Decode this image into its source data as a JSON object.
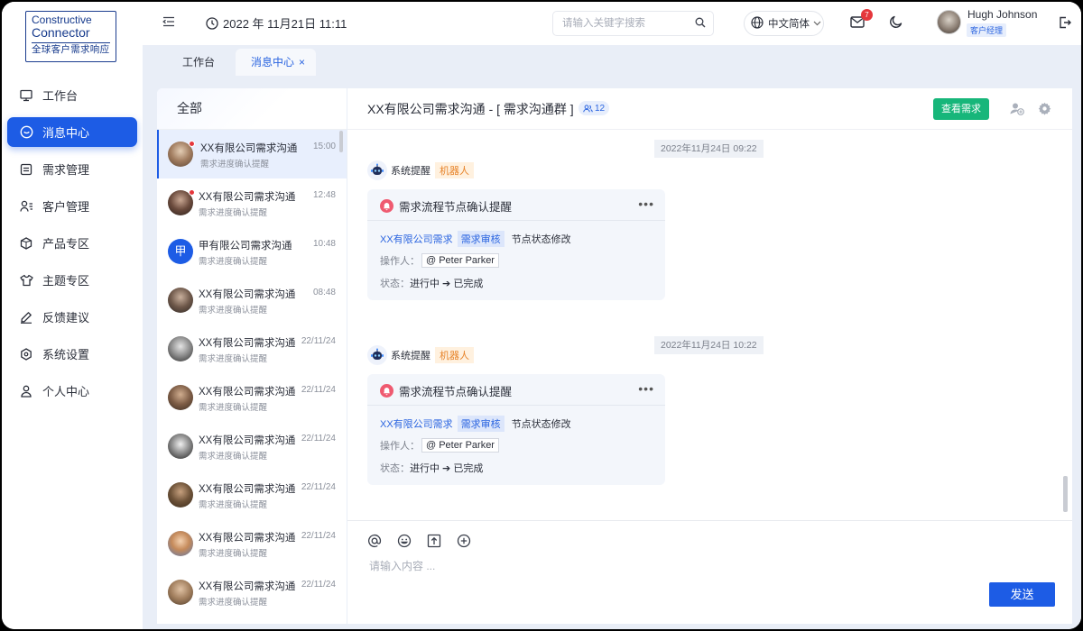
{
  "brand": {
    "line1": "Constructive",
    "line2": "Connector",
    "line3": "全球客户需求响应"
  },
  "sidebar": {
    "items": [
      {
        "label": "工作台",
        "icon": "monitor-icon"
      },
      {
        "label": "消息中心",
        "icon": "message-icon",
        "active": true
      },
      {
        "label": "需求管理",
        "icon": "list-icon"
      },
      {
        "label": "客户管理",
        "icon": "user-list-icon"
      },
      {
        "label": "产品专区",
        "icon": "cube-icon"
      },
      {
        "label": "主题专区",
        "icon": "shirt-icon"
      },
      {
        "label": "反馈建议",
        "icon": "edit-icon"
      },
      {
        "label": "系统设置",
        "icon": "settings-icon"
      },
      {
        "label": "个人中心",
        "icon": "person-icon"
      }
    ]
  },
  "header": {
    "datetime": "2022 年 11月21日 11:11",
    "search_placeholder": "请输入关键字搜索",
    "language": "中文简体",
    "mail_count": "7",
    "user_name": "Hugh  Johnson",
    "user_role": "客户经理"
  },
  "tabs": {
    "tab1": "工作台",
    "tab2": "消息中心",
    "close": "×"
  },
  "conversations": {
    "header": "全部",
    "items": [
      {
        "title": "XX有限公司需求沟通",
        "sub": "需求进度确认提醒",
        "time": "15:00",
        "unread": true
      },
      {
        "title": "XX有限公司需求沟通",
        "sub": "需求进度确认提醒",
        "time": "12:48",
        "unread": true
      },
      {
        "title": "甲有限公司需求沟通",
        "sub": "需求进度确认提醒",
        "time": "10:48",
        "unread": false,
        "letter": "甲"
      },
      {
        "title": "XX有限公司需求沟通",
        "sub": "需求进度确认提醒",
        "time": "08:48",
        "unread": false
      },
      {
        "title": "XX有限公司需求沟通",
        "sub": "需求进度确认提醒",
        "time": "22/11/24",
        "unread": false
      },
      {
        "title": "XX有限公司需求沟通",
        "sub": "需求进度确认提醒",
        "time": "22/11/24",
        "unread": false
      },
      {
        "title": "XX有限公司需求沟通",
        "sub": "需求进度确认提醒",
        "time": "22/11/24",
        "unread": false
      },
      {
        "title": "XX有限公司需求沟通",
        "sub": "需求进度确认提醒",
        "time": "22/11/24",
        "unread": false
      },
      {
        "title": "XX有限公司需求沟通",
        "sub": "需求进度确认提醒",
        "time": "22/11/24",
        "unread": false
      },
      {
        "title": "XX有限公司需求沟通",
        "sub": "需求进度确认提醒",
        "time": "22/11/24",
        "unread": false
      }
    ]
  },
  "chat": {
    "title": "XX有限公司需求沟通 - [ 需求沟通群 ]",
    "member_count": "12",
    "view_button": "查看需求",
    "messages": [
      {
        "timestamp": "2022年11月24日 09:22",
        "sender": "系统提醒",
        "tag": "机器人",
        "card_title": "需求流程节点确认提醒",
        "more": "•••",
        "company": "XX有限公司需求",
        "stage": "需求审核",
        "action": "节点状态修改",
        "operator_label": "操作人：",
        "operator": "@ Peter Parker",
        "status_label": "状态：",
        "status": "进行中 ➔ 已完成"
      },
      {
        "timestamp": "2022年11月24日 10:22",
        "sender": "系统提醒",
        "tag": "机器人",
        "card_title": "需求流程节点确认提醒",
        "more": "•••",
        "company": "XX有限公司需求",
        "stage": "需求审核",
        "action": "节点状态修改",
        "operator_label": "操作人：",
        "operator": "@ Peter Parker",
        "status_label": "状态：",
        "status": "进行中 ➔ 已完成"
      }
    ],
    "input_placeholder": "请输入内容 ...",
    "send_button": "发送"
  },
  "colors": {
    "primary": "#1d5ce5",
    "success": "#17b67a",
    "danger": "#e5373c",
    "robot_tag": "#e7832a"
  }
}
